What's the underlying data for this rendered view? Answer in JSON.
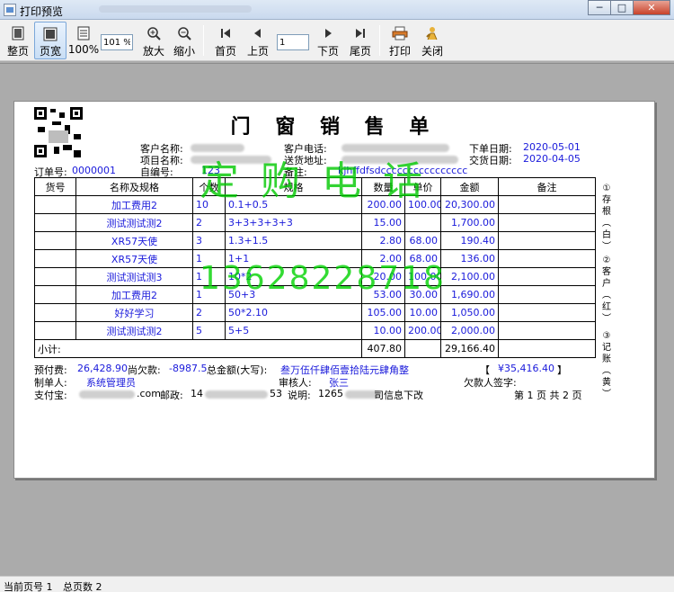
{
  "window": {
    "title": "打印预览",
    "buttons": {
      "minimize": "─",
      "maximize": "□",
      "close": "✕"
    }
  },
  "toolbar": {
    "whole_page": "整页",
    "page_width": "页宽",
    "zoom_100": "100%",
    "zoom_value": "101 %",
    "zoom_in": "放大",
    "zoom_out": "缩小",
    "first_page": "首页",
    "prev_page": "上页",
    "page_value": "1",
    "next_page": "下页",
    "last_page": "尾页",
    "print": "打印",
    "close": "关闭"
  },
  "document": {
    "title": "门 窗 销 售 单",
    "header": {
      "customer_name_label": "客户名称:",
      "customer_phone_label": "客户电话:",
      "order_date_label": "下单日期:",
      "order_date": "2020-05-01",
      "project_name_label": "项目名称:",
      "delivery_address_label": "送货地址:",
      "delivery_date_label": "交货日期:",
      "delivery_date": "2020-04-05",
      "order_no_label": "订单号:",
      "order_no": "0000001",
      "self_no_label": "自编号:",
      "self_no": "123",
      "remark_label": "备注:",
      "remark": "kjhffdfsdcccccccccccccccc"
    },
    "columns": [
      "货号",
      "名称及规格",
      "个数",
      "规格",
      "数量",
      "单价",
      "金额",
      "备注"
    ],
    "rows": [
      {
        "code": "",
        "name": "加工费用2",
        "count": "10",
        "spec": "0.1+0.5",
        "qty": "200.00",
        "price": "100.00",
        "amount": "20,300.00",
        "note": ""
      },
      {
        "code": "",
        "name": "测试测试测2",
        "count": "2",
        "spec": "3+3+3+3+3",
        "qty": "15.00",
        "price": "",
        "amount": "1,700.00",
        "note": ""
      },
      {
        "code": "",
        "name": "XR57天使",
        "count": "3",
        "spec": "1.3+1.5",
        "qty": "2.80",
        "price": "68.00",
        "amount": "190.40",
        "note": ""
      },
      {
        "code": "",
        "name": "XR57天使",
        "count": "1",
        "spec": "1+1",
        "qty": "2.00",
        "price": "68.00",
        "amount": "136.00",
        "note": ""
      },
      {
        "code": "",
        "name": "测试测试测3",
        "count": "1",
        "spec": "10*2",
        "qty": "20.00",
        "price": "100.00",
        "amount": "2,100.00",
        "note": ""
      },
      {
        "code": "",
        "name": "加工费用2",
        "count": "1",
        "spec": "50+3",
        "qty": "53.00",
        "price": "30.00",
        "amount": "1,690.00",
        "note": ""
      },
      {
        "code": "",
        "name": "好好学习",
        "count": "2",
        "spec": "50*2.10",
        "qty": "105.00",
        "price": "10.00",
        "amount": "1,050.00",
        "note": ""
      },
      {
        "code": "",
        "name": "测试测试测2",
        "count": "5",
        "spec": "5+5",
        "qty": "10.00",
        "price": "200.00",
        "amount": "2,000.00",
        "note": ""
      }
    ],
    "subtotal_label": "小计:",
    "subtotal_qty": "407.80",
    "subtotal_amount": "29,166.40",
    "footer": {
      "prepaid_label": "预付费:",
      "prepaid": "26,428.90",
      "owed_label": "尚欠款:",
      "owed": "-8987.5",
      "total_caps_label": "总金额(大写):",
      "total_caps": "叁万伍仟肆佰壹拾陆元肆角整",
      "total_bracket_open": "【",
      "total_value": "¥35,416.40",
      "total_bracket_close": "】",
      "maker_label": "制单人:",
      "maker": "系统管理员",
      "auditor_label": "审核人:",
      "auditor": "张三",
      "debtor_label": "欠款人签字:",
      "alipay_label": "支付宝:",
      "alipay_suffix": ".com",
      "postcode_label": "邮政:",
      "postcode_prefix": "14",
      "postcode_suffix": "53",
      "note_label": "说明:",
      "note_prefix": "1265",
      "note_suffix": "司信息下改",
      "page_info": "第 1 页  共 2 页"
    },
    "side_labels": [
      "①存根(白)",
      "②客户(红)",
      "③记账(黄)"
    ],
    "watermarks": [
      "定购电话",
      "13628228718"
    ]
  },
  "status": {
    "current_page": "当前页号 1",
    "total_pages": "总页数 2"
  },
  "colors": {
    "watermark": "#00c800",
    "field_value": "#1a1adb"
  }
}
